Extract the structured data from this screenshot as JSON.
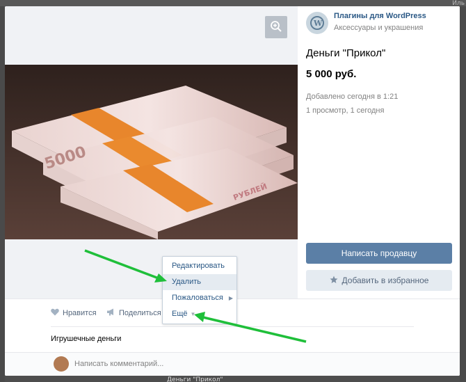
{
  "backdrop": {
    "bottom_text": "Деньги \"Прикол\"",
    "topright_text": "Иль"
  },
  "group": {
    "name": "Плагины для WordPress",
    "subtitle": "Аксессуары и украшения"
  },
  "item": {
    "title": "Деньги \"Прикол\"",
    "price": "5 000 руб.",
    "added": "Добавлено сегодня в 1:21",
    "views": "1 просмотр, 1 сегодня",
    "description": "Игрушечные деньги"
  },
  "buttons": {
    "contact_seller": "Написать продавцу",
    "add_favorite": "Добавить в избранное"
  },
  "actions": {
    "like": "Нравится",
    "share": "Поделиться",
    "more": "Ещё"
  },
  "menu": {
    "items": [
      {
        "label": "Редактировать"
      },
      {
        "label": "Удалить"
      },
      {
        "label": "Пожаловаться"
      },
      {
        "label": "Ещё"
      }
    ]
  },
  "comment": {
    "placeholder": "Написать комментарий..."
  },
  "colors": {
    "accent": "#5b7fa6",
    "link": "#2a5885",
    "arrow": "#1fbf3a"
  },
  "icons": {
    "zoom": "zoom-in-icon",
    "star": "star-icon",
    "heart": "heart-icon",
    "share": "megaphone-icon"
  }
}
